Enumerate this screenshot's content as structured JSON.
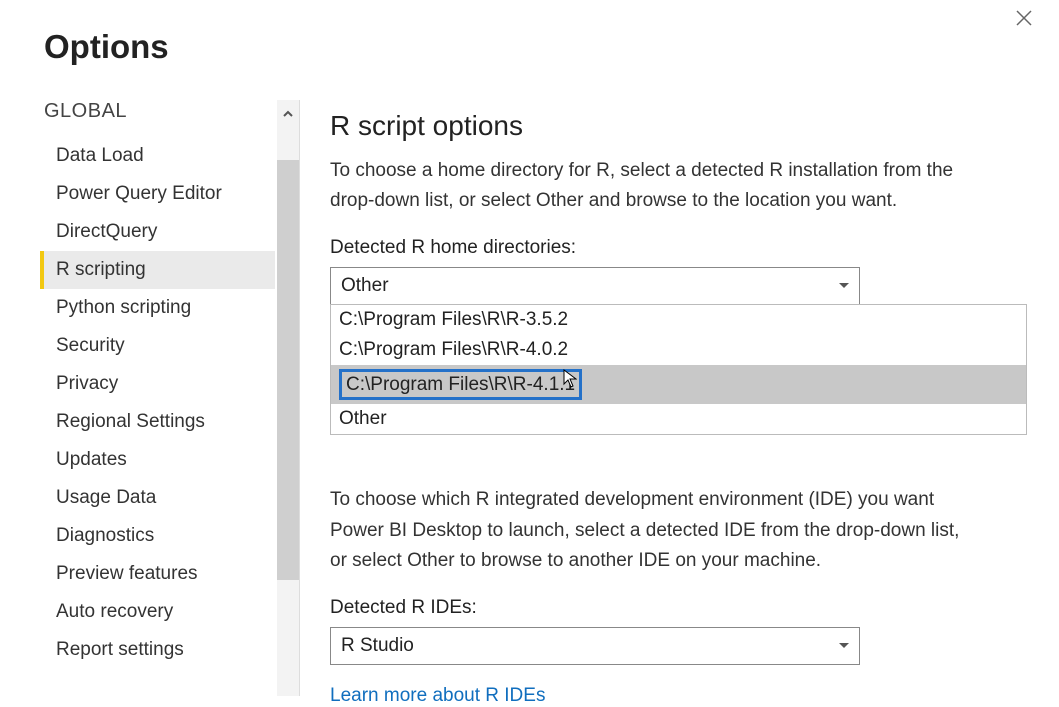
{
  "window": {
    "title": "Options"
  },
  "sidebar": {
    "section": "GLOBAL",
    "items": [
      {
        "label": "Data Load"
      },
      {
        "label": "Power Query Editor"
      },
      {
        "label": "DirectQuery"
      },
      {
        "label": "R scripting"
      },
      {
        "label": "Python scripting"
      },
      {
        "label": "Security"
      },
      {
        "label": "Privacy"
      },
      {
        "label": "Regional Settings"
      },
      {
        "label": "Updates"
      },
      {
        "label": "Usage Data"
      },
      {
        "label": "Diagnostics"
      },
      {
        "label": "Preview features"
      },
      {
        "label": "Auto recovery"
      },
      {
        "label": "Report settings"
      }
    ]
  },
  "content": {
    "heading": "R script options",
    "desc1": "To choose a home directory for R, select a detected R installation from the drop-down list, or select Other and browse to the location you want.",
    "homeLabel": "Detected R home directories:",
    "homeSelected": "Other",
    "homeOptions": [
      "C:\\Program Files\\R\\R-3.5.2",
      "C:\\Program Files\\R\\R-4.0.2",
      "C:\\Program Files\\R\\R-4.1.1",
      "Other"
    ],
    "desc2": "To choose which R integrated development environment (IDE) you want Power BI Desktop to launch, select a detected IDE from the drop-down list, or select Other to browse to another IDE on your machine.",
    "ideLabel": "Detected R IDEs:",
    "ideSelected": "R Studio",
    "linkText": "Learn more about R IDEs"
  }
}
